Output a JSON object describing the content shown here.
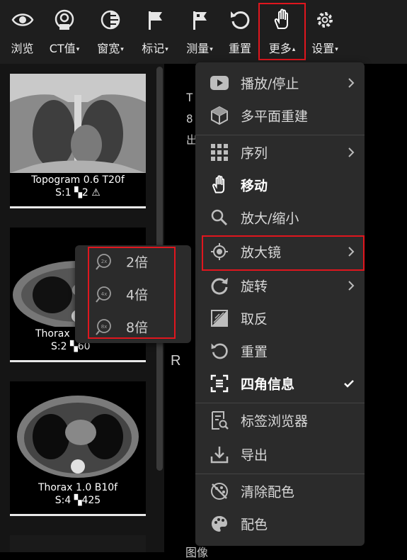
{
  "toolbar": {
    "items": [
      {
        "label": "浏览",
        "icon": "eye-icon"
      },
      {
        "label": "CT值",
        "icon": "ct-value-icon",
        "caret": "▾"
      },
      {
        "label": "窗宽",
        "icon": "window-level-icon",
        "caret": "▾"
      },
      {
        "label": "标记",
        "icon": "flag-icon",
        "caret": "▾"
      },
      {
        "label": "测量",
        "icon": "measure-flag-icon",
        "caret": "▾"
      },
      {
        "label": "重置",
        "icon": "reset-icon"
      },
      {
        "label": "更多",
        "icon": "hand-icon",
        "caret": "▴"
      },
      {
        "label": "设置",
        "icon": "gear-icon",
        "caret": "▾"
      }
    ]
  },
  "series": [
    {
      "name": "Topogram 0.6 T20f",
      "stats": "S:1   ▚2   ⚠"
    },
    {
      "name": "Thorax",
      "stats": "S:2   ▚60"
    },
    {
      "name": "Thorax 1.0 B10f",
      "stats": "S:4   ▚425"
    }
  ],
  "viewer": {
    "line1": "T",
    "line2": "8",
    "line3": "出",
    "orientation": "R",
    "bottom": "图像"
  },
  "menu": {
    "items": [
      {
        "label": "播放/停止",
        "icon": "play-icon",
        "submenu": true
      },
      {
        "label": "多平面重建",
        "icon": "cube-icon"
      },
      {
        "label": "序列",
        "icon": "grid-icon",
        "submenu": true
      },
      {
        "label": "移动",
        "icon": "hand-icon",
        "bold": true
      },
      {
        "label": "放大/缩小",
        "icon": "zoom-icon"
      },
      {
        "label": "放大镜",
        "icon": "magnifier-target-icon",
        "submenu": true
      },
      {
        "label": "旋转",
        "icon": "rotate-icon",
        "submenu": true
      },
      {
        "label": "取反",
        "icon": "invert-icon"
      },
      {
        "label": "重置",
        "icon": "reset-icon"
      },
      {
        "label": "四角信息",
        "icon": "corner-info-icon",
        "bold": true,
        "checked": true
      },
      {
        "label": "标签浏览器",
        "icon": "tag-browser-icon"
      },
      {
        "label": "导出",
        "icon": "export-icon"
      },
      {
        "label": "清除配色",
        "icon": "clear-color-icon"
      },
      {
        "label": "配色",
        "icon": "palette-icon"
      }
    ]
  },
  "submenu": {
    "items": [
      {
        "label": "2倍",
        "badge": "2x"
      },
      {
        "label": "4倍",
        "badge": "4x"
      },
      {
        "label": "8倍",
        "badge": "8x"
      }
    ]
  },
  "colors": {
    "highlight": "#e0161e",
    "menu_bg": "#2b2b2b",
    "toolbar_bg": "#1e1e1e"
  }
}
